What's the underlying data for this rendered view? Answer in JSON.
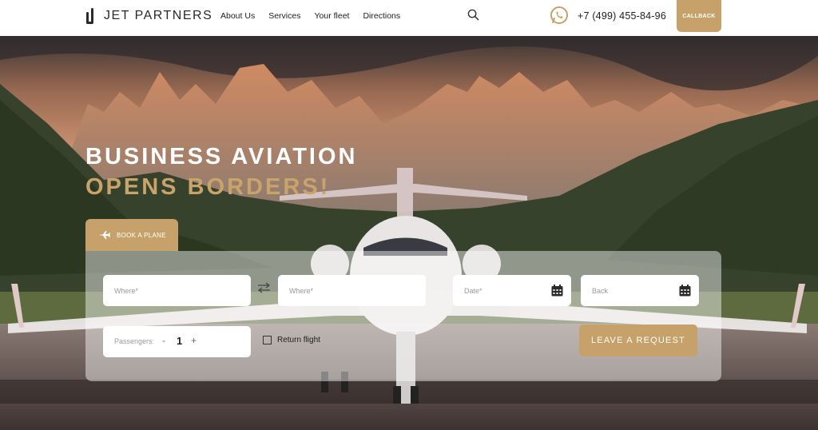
{
  "brand": {
    "name": "JET PARTNERS"
  },
  "nav": {
    "items": [
      "About Us",
      "Services",
      "Your fleet",
      "Directions"
    ]
  },
  "header": {
    "phone": "+7 (499) 455-84-96",
    "callback_label": "CALLBACK",
    "search_icon": "search-icon",
    "whatsapp_icon": "whatsapp-icon"
  },
  "hero": {
    "title_line1": "BUSINESS AVIATION",
    "title_line2": "OPENS BORDERS!"
  },
  "booking": {
    "tab_label": "BOOK A PLANE",
    "from_placeholder": "Where*",
    "to_placeholder": "Where*",
    "date_placeholder": "Date*",
    "back_placeholder": "Back",
    "passengers_label": "Passengers:",
    "passengers_minus": "-",
    "passengers_value": "1",
    "passengers_plus": "+",
    "return_label": "Return flight",
    "submit_label": "LEAVE A REQUEST"
  },
  "colors": {
    "accent": "#c6a26a",
    "headline_gold": "#c8a46a",
    "text_dark": "#1e1e1e",
    "panel_overlay": "rgba(255,255,255,0.45)"
  }
}
